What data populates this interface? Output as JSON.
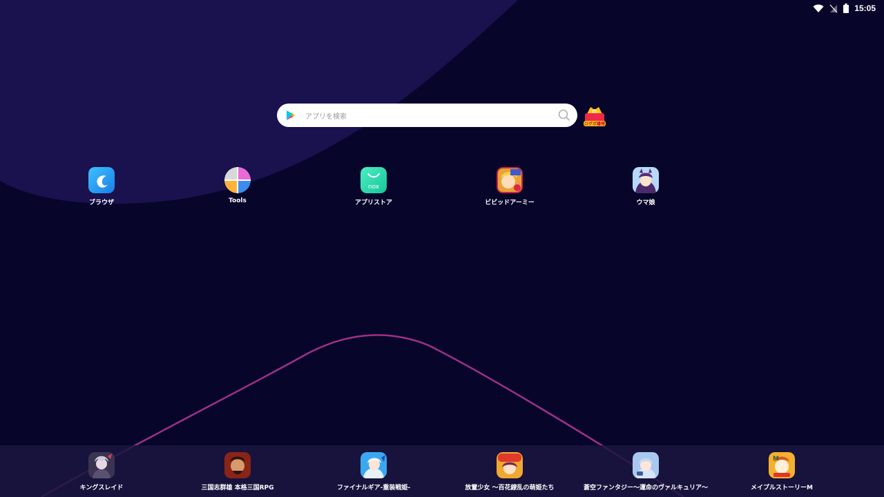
{
  "status_bar": {
    "time": "15:05",
    "wifi_icon": "wifi-icon",
    "signal_icon": "no-signal-icon",
    "battery_icon": "battery-icon"
  },
  "search": {
    "placeholder": "アプリを検索",
    "play_icon": "google-play-icon",
    "search_icon": "magnifier-icon",
    "gift_label": "ログボ獲得"
  },
  "desktop_apps": [
    {
      "label": "ブラウザ",
      "icon": "browser-icon"
    },
    {
      "label": "Tools",
      "icon": "tools-icon"
    },
    {
      "label": "アプリストア",
      "icon": "app-store-icon"
    },
    {
      "label": "ビビッドアーミー",
      "icon": "vivid-army-icon"
    },
    {
      "label": "ウマ娘",
      "icon": "uma-musume-icon"
    }
  ],
  "dock_apps": [
    {
      "label": "キングスレイド",
      "icon": "kings-raid-icon"
    },
    {
      "label": "三国志群雄 本格三国RPG",
      "icon": "sangokushi-icon"
    },
    {
      "label": "ファイナルギア-重装戦姫-",
      "icon": "final-gear-icon"
    },
    {
      "label": "放置少女 〜百花繚乱の萌姫たち",
      "icon": "houchi-shoujo-icon"
    },
    {
      "label": "蒼空ファンタジー〜運命のヴァルキュリア〜",
      "icon": "soukuu-fantasy-icon"
    },
    {
      "label": "メイプルストーリーM",
      "icon": "maplestory-m-icon"
    }
  ],
  "colors": {
    "background": "#07052a",
    "wave": "#1a1458",
    "curve": "#a0308a",
    "dock": "#1a1640"
  }
}
